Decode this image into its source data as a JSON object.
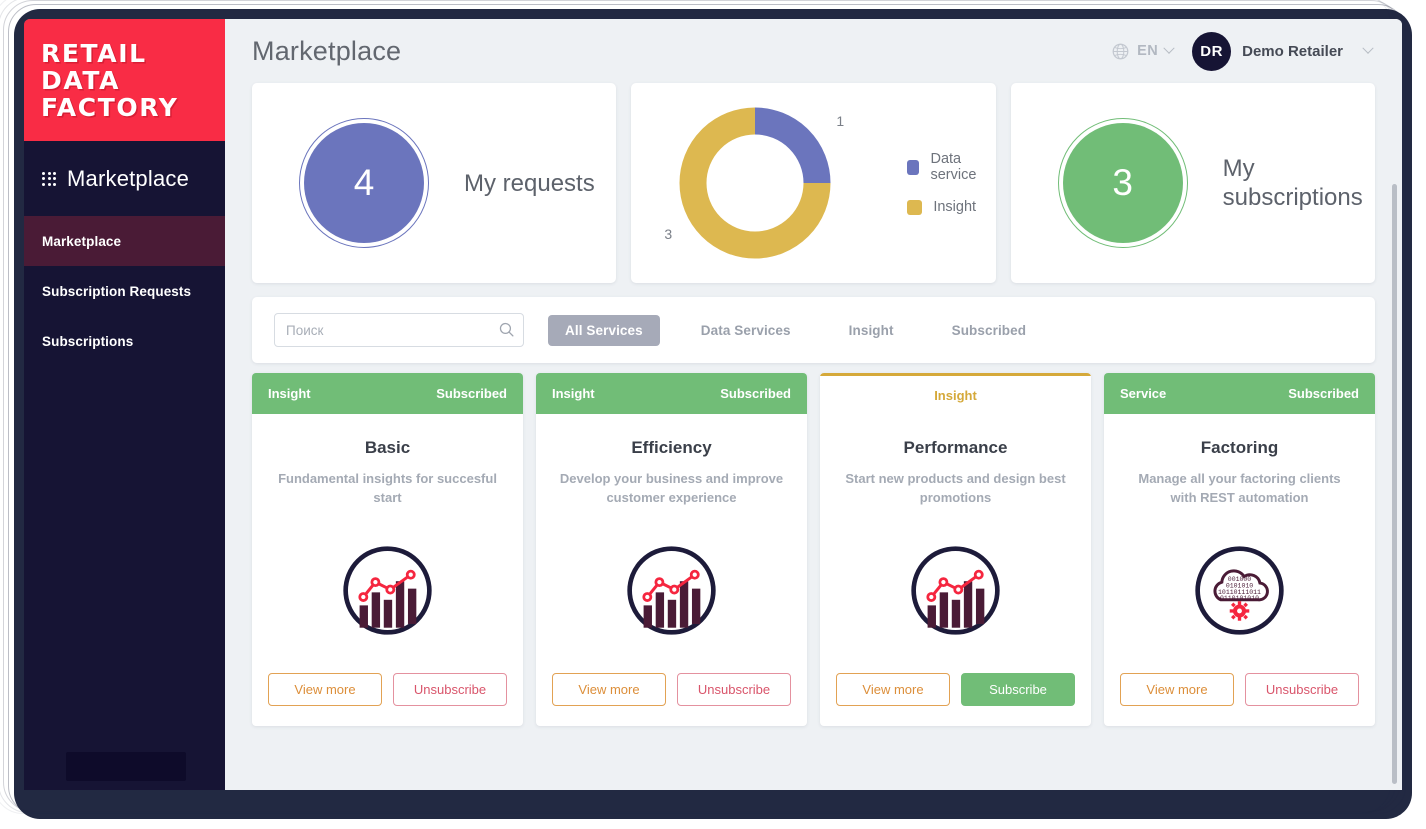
{
  "sidebar": {
    "brand": {
      "line1": "RETAIL",
      "line2": "DATA",
      "line3": "FACTORY"
    },
    "section": {
      "icon": "grid-dots-icon",
      "title": "Marketplace"
    },
    "items": [
      {
        "label": "Marketplace",
        "active": true
      },
      {
        "label": "Subscription Requests",
        "active": false
      },
      {
        "label": "Subscriptions",
        "active": false
      }
    ]
  },
  "topbar": {
    "title": "Marketplace",
    "language": {
      "icon": "globe-icon",
      "label": "EN",
      "chevron": "chevron-down-icon"
    },
    "user": {
      "initials": "DR",
      "name": "Demo Retailer",
      "chevron": "chevron-down-icon"
    }
  },
  "stats": {
    "requests": {
      "value": "4",
      "label": "My requests",
      "color": "#6b75bd"
    },
    "subscriptions": {
      "value": "3",
      "label": "My subscriptions",
      "color": "#71bd77"
    }
  },
  "chart_data": {
    "type": "pie",
    "title": "",
    "categories": [
      "Data service",
      "Insight"
    ],
    "values": [
      1,
      3
    ],
    "colors": [
      "#6b75bd",
      "#ddb850"
    ],
    "labels": [
      "1",
      "3"
    ],
    "legend_position": "right",
    "donut": true
  },
  "filters": {
    "search": {
      "placeholder": "Поиск",
      "value": "",
      "icon": "search-icon"
    },
    "tabs": [
      {
        "label": "All Services",
        "active": true
      },
      {
        "label": "Data Services",
        "active": false
      },
      {
        "label": "Insight",
        "active": false
      },
      {
        "label": "Subscribed",
        "active": false
      }
    ]
  },
  "cards": [
    {
      "category": "Insight",
      "status": "Subscribed",
      "header_style": "green",
      "title": "Basic",
      "description": "Fundamental insights for succesful start",
      "icon": "bar-chart-circle-icon",
      "primary_button": "View more",
      "secondary_button": "Unsubscribe",
      "secondary_style": "unsub"
    },
    {
      "category": "Insight",
      "status": "Subscribed",
      "header_style": "green",
      "title": "Efficiency",
      "description": "Develop your business and improve customer experience",
      "icon": "bar-chart-circle-icon",
      "primary_button": "View more",
      "secondary_button": "Unsubscribe",
      "secondary_style": "unsub"
    },
    {
      "category": "Insight",
      "status": "",
      "header_style": "plain",
      "title": "Performance",
      "description": "Start new products and design best promotions",
      "icon": "bar-chart-circle-icon",
      "primary_button": "View more",
      "secondary_button": "Subscribe",
      "secondary_style": "sub"
    },
    {
      "category": "Service",
      "status": "Subscribed",
      "header_style": "green",
      "title": "Factoring",
      "description": "Manage all your factoring clients with REST automation",
      "icon": "cloud-binary-gear-icon",
      "primary_button": "View more",
      "secondary_button": "Unsubscribe",
      "secondary_style": "unsub"
    }
  ]
}
